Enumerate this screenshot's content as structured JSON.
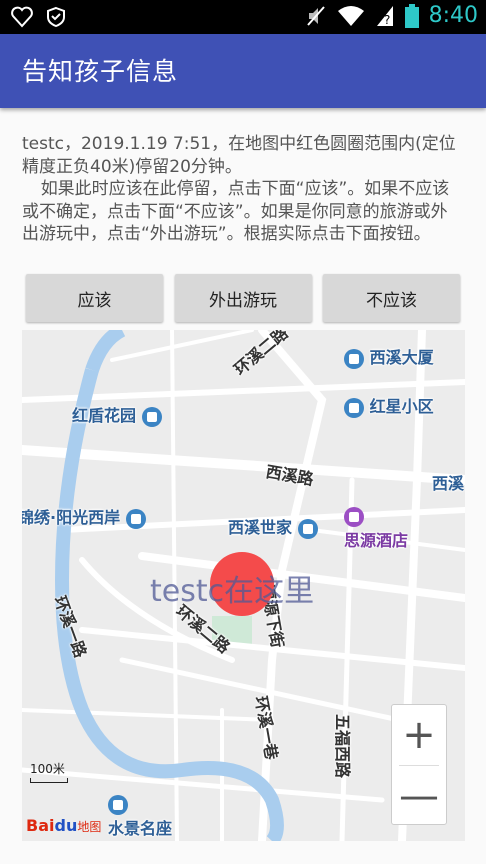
{
  "status_bar": {
    "time": "8:40"
  },
  "app_bar": {
    "title": "告知孩子信息"
  },
  "message": {
    "line1": "testc，2019.1.19 7:51，在地图中红色圆圈范围内(定位精度正负40米)停留20分钟。",
    "line2": "如果此时应该在此停留，点击下面“应该”。如果不应该或不确定，点击下面“不应该”。如果是你同意的旅游或外出游玩中，点击“外出游玩”。根据实际点击下面按钮。"
  },
  "buttons": {
    "yes": "应该",
    "travel": "外出游玩",
    "no": "不应该"
  },
  "map": {
    "marker_label": "testc在这里",
    "labels": {
      "xixi_dasha": "西溪大厦",
      "hongxing": "红星小区",
      "hongdun": "红盾花园",
      "huanxi_road_top": "环溪二路",
      "xixi_road": "西溪路",
      "xixi_right": "西溪",
      "jinxiu": "锦绣·阳光西岸",
      "xixi_shijia": "西溪世家",
      "siyuan": "思源酒店",
      "huanxi_1": "环溪一路",
      "huanxi_2": "环溪二路",
      "fuyuan": "福源下街",
      "huanxi_lane": "环溪一巷",
      "wufu": "五福西路",
      "shuijing": "水景名座"
    },
    "scale": "100米",
    "logo": {
      "bai": "Bai",
      "du": "du",
      "ditu": "地图"
    },
    "zoom_in": "+",
    "zoom_out": "—"
  },
  "colors": {
    "app_bar": "#3f51b5",
    "marker": "#f44b4b",
    "river": "#a9cdee"
  }
}
